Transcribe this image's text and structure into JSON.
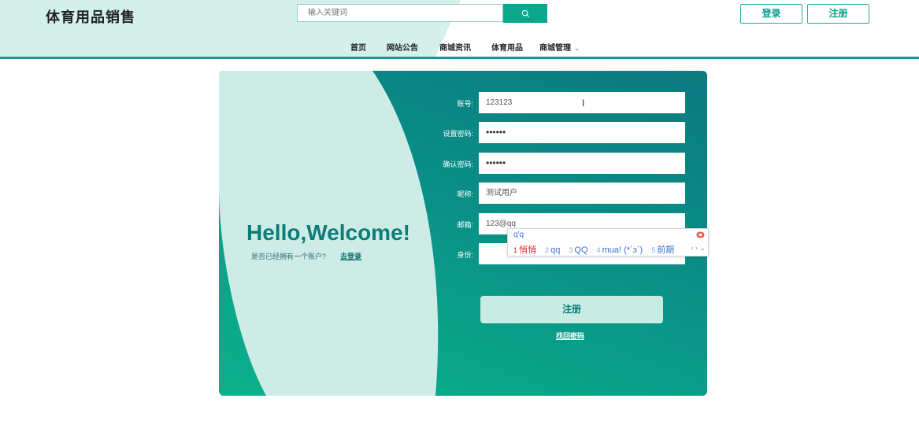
{
  "header": {
    "brand": "体育用品销售",
    "search": {
      "placeholder": "输入关键词"
    },
    "login_label": "登录",
    "register_label": "注册"
  },
  "nav": {
    "items": [
      "首页",
      "网站公告",
      "商城资讯",
      "体育用品",
      "商城管理"
    ]
  },
  "welcome": {
    "title": "Hello,Welcome!",
    "question": "是否已经拥有一个账户?",
    "login_link": "去登录"
  },
  "form": {
    "fields": [
      {
        "label": "账号:",
        "value": "123123"
      },
      {
        "label": "设置密码:",
        "value": "••••••"
      },
      {
        "label": "确认密码:",
        "value": "••••••"
      },
      {
        "label": "昵称:",
        "value": "测试用户"
      },
      {
        "label": "邮箱:",
        "value": "123@qq"
      },
      {
        "label": "身份:",
        "value": ""
      }
    ],
    "submit_label": "注册",
    "forgot_label": "找回密码"
  },
  "ime": {
    "input": "q'q",
    "candidates": [
      {
        "num": "1",
        "text": "悄悄"
      },
      {
        "num": "2",
        "text": "qq"
      },
      {
        "num": "3",
        "text": "QQ"
      },
      {
        "num": "4",
        "text": "mua! (*´з`)"
      },
      {
        "num": "5",
        "text": "前期"
      }
    ],
    "arrows": "‹ › ⌄"
  },
  "colors": {
    "accent": "#0ca68f",
    "card_dark": "#0b7a80",
    "card_light": "#cdece6",
    "header_shape": "#d3f0ea"
  }
}
